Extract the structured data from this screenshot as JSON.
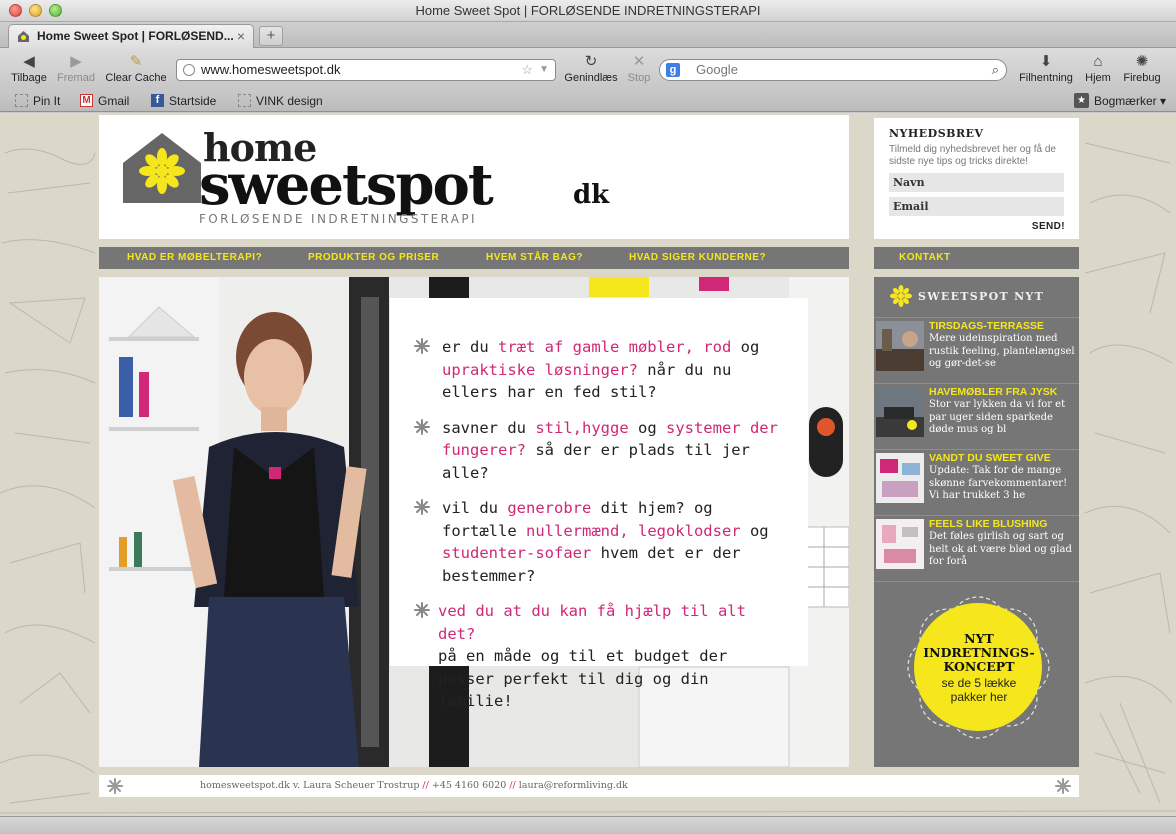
{
  "window": {
    "title": "Home Sweet Spot | FORLØSENDE INDRETNINGSTERAPI"
  },
  "tab": {
    "title": "Home Sweet Spot | FORLØSEND...",
    "close": "×",
    "new_tab": "+"
  },
  "toolbar": {
    "back": "Tilbage",
    "forward": "Fremad",
    "clear_cache": "Clear Cache",
    "reload": "Genindlæs",
    "stop": "Stop",
    "downloads": "Filhentning",
    "home": "Hjem",
    "firebug": "Firebug"
  },
  "urlbar": {
    "value": "www.homesweetspot.dk"
  },
  "searchbar": {
    "placeholder": "Google",
    "engine_letter": "g"
  },
  "bookmarks": {
    "items": [
      {
        "label": "Pin It"
      },
      {
        "label": "Gmail"
      },
      {
        "label": "Startside"
      },
      {
        "label": "VINK design"
      }
    ],
    "menu": "Bogmærker"
  },
  "site": {
    "logo": {
      "home": "home",
      "sweetspot": "sweetspot",
      "dk": "dk",
      "tagline": "FORLØSENDE INDRETNINGSTERAPI"
    },
    "newsletter": {
      "title": "NYHEDSBREV",
      "text": "Tilmeld dig nyhedsbrevet her og få de sidste nye tips og tricks direkte!",
      "name_placeholder": "Navn",
      "email_placeholder": "Email",
      "send": "SEND!"
    },
    "nav": [
      {
        "label": "HVAD ER MØBELTERAPI?"
      },
      {
        "label": "PRODUKTER OG PRISER"
      },
      {
        "label": "HVEM STÅR BAG?"
      },
      {
        "label": "HVAD SIGER KUNDERNE?"
      }
    ],
    "kontakt": "KONTAKT",
    "hero": {
      "p1": {
        "a": "er du ",
        "b": "træt af gamle møbler, rod",
        "c": " og ",
        "d": "upraktiske løsninger?",
        "e": " når du nu ellers har en fed stil?"
      },
      "p2": {
        "a": "savner du ",
        "b": "stil,hygge",
        "c": " og ",
        "d": "systemer der fungerer?",
        "e": " så der er plads til jer alle?"
      },
      "p3": {
        "a": "vil du ",
        "b": "generobre",
        "c": " dit hjem? og fortælle ",
        "d": "nullermænd, legoklodser",
        "e": " og ",
        "f": "studenter-sofaer",
        "g": "  hvem det er der bestemmer?"
      },
      "p4": {
        "a": "ved du at du kan få hjælp til alt det?",
        "b": "på en måde og til et budget der passer perfekt til dig og din familie!"
      }
    },
    "sidebar": {
      "title": "SWEETSPOT NYT",
      "news": [
        {
          "title": "TIRSDAGS-TERRASSE",
          "body": "Mere udeinspiration med rustik feeling, plantelængsel og gør-det-se"
        },
        {
          "title": "HAVEMØBLER FRA JYSK",
          "body": "Stor var lykken da vi  for et par uger siden sparkede døde mus og bl"
        },
        {
          "title": "VANDT DU SWEET GIVE",
          "body": "Update: Tak for de mange skønne farvekommentarer! Vi har trukket 3 he"
        },
        {
          "title": "FEELS LIKE BLUSHING",
          "body": "Det føles girlish og sart og helt ok at være blød og glad for forå"
        }
      ],
      "badge": {
        "line1": "NYT",
        "line2": "INDRETNINGS-",
        "line3": "KONCEPT",
        "line4": "se de 5 lække",
        "line5": "pakker her"
      }
    },
    "footer": {
      "owner": "homesweetspot.dk v. Laura Scheuer Trostrup",
      "sep": " // ",
      "phone": "+45 4160 6020",
      "email": "laura@reformliving.dk"
    }
  },
  "colors": {
    "accent_yellow": "#f5e71c",
    "accent_pink": "#d12777",
    "nav_gray": "#767676"
  }
}
